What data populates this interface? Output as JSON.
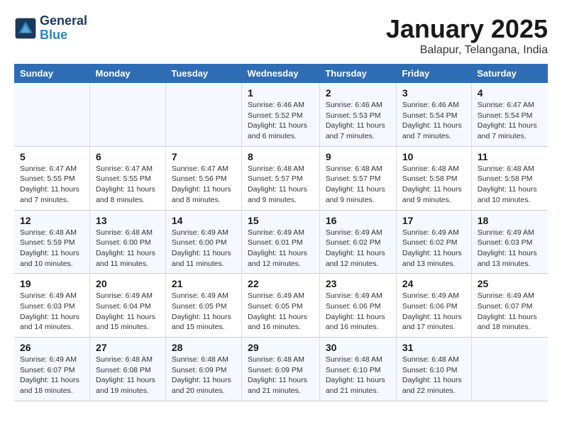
{
  "header": {
    "logo_line1": "General",
    "logo_line2": "Blue",
    "month": "January 2025",
    "location": "Balapur, Telangana, India"
  },
  "days_of_week": [
    "Sunday",
    "Monday",
    "Tuesday",
    "Wednesday",
    "Thursday",
    "Friday",
    "Saturday"
  ],
  "weeks": [
    [
      {
        "num": "",
        "info": ""
      },
      {
        "num": "",
        "info": ""
      },
      {
        "num": "",
        "info": ""
      },
      {
        "num": "1",
        "info": "Sunrise: 6:46 AM\nSunset: 5:52 PM\nDaylight: 11 hours and 6 minutes."
      },
      {
        "num": "2",
        "info": "Sunrise: 6:46 AM\nSunset: 5:53 PM\nDaylight: 11 hours and 7 minutes."
      },
      {
        "num": "3",
        "info": "Sunrise: 6:46 AM\nSunset: 5:54 PM\nDaylight: 11 hours and 7 minutes."
      },
      {
        "num": "4",
        "info": "Sunrise: 6:47 AM\nSunset: 5:54 PM\nDaylight: 11 hours and 7 minutes."
      }
    ],
    [
      {
        "num": "5",
        "info": "Sunrise: 6:47 AM\nSunset: 5:55 PM\nDaylight: 11 hours and 7 minutes."
      },
      {
        "num": "6",
        "info": "Sunrise: 6:47 AM\nSunset: 5:55 PM\nDaylight: 11 hours and 8 minutes."
      },
      {
        "num": "7",
        "info": "Sunrise: 6:47 AM\nSunset: 5:56 PM\nDaylight: 11 hours and 8 minutes."
      },
      {
        "num": "8",
        "info": "Sunrise: 6:48 AM\nSunset: 5:57 PM\nDaylight: 11 hours and 9 minutes."
      },
      {
        "num": "9",
        "info": "Sunrise: 6:48 AM\nSunset: 5:57 PM\nDaylight: 11 hours and 9 minutes."
      },
      {
        "num": "10",
        "info": "Sunrise: 6:48 AM\nSunset: 5:58 PM\nDaylight: 11 hours and 9 minutes."
      },
      {
        "num": "11",
        "info": "Sunrise: 6:48 AM\nSunset: 5:58 PM\nDaylight: 11 hours and 10 minutes."
      }
    ],
    [
      {
        "num": "12",
        "info": "Sunrise: 6:48 AM\nSunset: 5:59 PM\nDaylight: 11 hours and 10 minutes."
      },
      {
        "num": "13",
        "info": "Sunrise: 6:48 AM\nSunset: 6:00 PM\nDaylight: 11 hours and 11 minutes."
      },
      {
        "num": "14",
        "info": "Sunrise: 6:49 AM\nSunset: 6:00 PM\nDaylight: 11 hours and 11 minutes."
      },
      {
        "num": "15",
        "info": "Sunrise: 6:49 AM\nSunset: 6:01 PM\nDaylight: 11 hours and 12 minutes."
      },
      {
        "num": "16",
        "info": "Sunrise: 6:49 AM\nSunset: 6:02 PM\nDaylight: 11 hours and 12 minutes."
      },
      {
        "num": "17",
        "info": "Sunrise: 6:49 AM\nSunset: 6:02 PM\nDaylight: 11 hours and 13 minutes."
      },
      {
        "num": "18",
        "info": "Sunrise: 6:49 AM\nSunset: 6:03 PM\nDaylight: 11 hours and 13 minutes."
      }
    ],
    [
      {
        "num": "19",
        "info": "Sunrise: 6:49 AM\nSunset: 6:03 PM\nDaylight: 11 hours and 14 minutes."
      },
      {
        "num": "20",
        "info": "Sunrise: 6:49 AM\nSunset: 6:04 PM\nDaylight: 11 hours and 15 minutes."
      },
      {
        "num": "21",
        "info": "Sunrise: 6:49 AM\nSunset: 6:05 PM\nDaylight: 11 hours and 15 minutes."
      },
      {
        "num": "22",
        "info": "Sunrise: 6:49 AM\nSunset: 6:05 PM\nDaylight: 11 hours and 16 minutes."
      },
      {
        "num": "23",
        "info": "Sunrise: 6:49 AM\nSunset: 6:06 PM\nDaylight: 11 hours and 16 minutes."
      },
      {
        "num": "24",
        "info": "Sunrise: 6:49 AM\nSunset: 6:06 PM\nDaylight: 11 hours and 17 minutes."
      },
      {
        "num": "25",
        "info": "Sunrise: 6:49 AM\nSunset: 6:07 PM\nDaylight: 11 hours and 18 minutes."
      }
    ],
    [
      {
        "num": "26",
        "info": "Sunrise: 6:49 AM\nSunset: 6:07 PM\nDaylight: 11 hours and 18 minutes."
      },
      {
        "num": "27",
        "info": "Sunrise: 6:48 AM\nSunset: 6:08 PM\nDaylight: 11 hours and 19 minutes."
      },
      {
        "num": "28",
        "info": "Sunrise: 6:48 AM\nSunset: 6:09 PM\nDaylight: 11 hours and 20 minutes."
      },
      {
        "num": "29",
        "info": "Sunrise: 6:48 AM\nSunset: 6:09 PM\nDaylight: 11 hours and 21 minutes."
      },
      {
        "num": "30",
        "info": "Sunrise: 6:48 AM\nSunset: 6:10 PM\nDaylight: 11 hours and 21 minutes."
      },
      {
        "num": "31",
        "info": "Sunrise: 6:48 AM\nSunset: 6:10 PM\nDaylight: 11 hours and 22 minutes."
      },
      {
        "num": "",
        "info": ""
      }
    ]
  ]
}
